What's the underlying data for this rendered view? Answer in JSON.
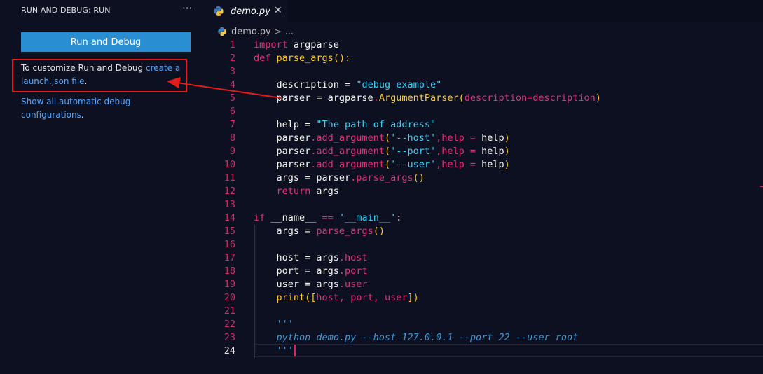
{
  "sidebar": {
    "title": "RUN AND DEBUG: RUN",
    "more": "···",
    "run_button": "Run and Debug",
    "customize_text": "To customize Run and Debug ",
    "customize_link": "create a launch.json file",
    "customize_end": ".",
    "show_all_link": "Show all automatic debug configurations",
    "show_all_end": "."
  },
  "tab": {
    "label": "demo.py",
    "close": "✕"
  },
  "breadcrumb": {
    "file": "demo.py",
    "sep": ">",
    "more": "..."
  },
  "colors": {
    "button": "#2a8ed3",
    "link": "#4fa6ff",
    "annotation": "#e21b1b",
    "editor_bg": "#0c1021"
  },
  "code": {
    "current_line": 24,
    "lines": [
      [
        [
          "k",
          "import"
        ],
        [
          "p",
          " argparse"
        ]
      ],
      [
        [
          "k",
          "def"
        ],
        [
          "p",
          " "
        ],
        [
          "f",
          "parse_args"
        ],
        [
          "f",
          "():"
        ]
      ],
      [],
      [
        [
          "p",
          "    description = "
        ],
        [
          "s",
          "\"debug example\""
        ]
      ],
      [
        [
          "p",
          "    parser = argparse"
        ],
        [
          "m",
          "."
        ],
        [
          "f",
          "ArgumentParser"
        ],
        [
          "f",
          "("
        ],
        [
          "m",
          "description=description"
        ],
        [
          "f",
          ")"
        ]
      ],
      [],
      [
        [
          "p",
          "    help = "
        ],
        [
          "s",
          "\"The path of address\""
        ]
      ],
      [
        [
          "p",
          "    parser"
        ],
        [
          "m",
          ".add_argument"
        ],
        [
          "f",
          "("
        ],
        [
          "s",
          "'--host'"
        ],
        [
          "m",
          ",help = "
        ],
        [
          "p",
          "help"
        ],
        [
          "f",
          ")"
        ]
      ],
      [
        [
          "p",
          "    parser"
        ],
        [
          "m",
          ".add_argument"
        ],
        [
          "f",
          "("
        ],
        [
          "s",
          "'--port'"
        ],
        [
          "m",
          ",help = "
        ],
        [
          "p",
          "help"
        ],
        [
          "f",
          ")"
        ]
      ],
      [
        [
          "p",
          "    parser"
        ],
        [
          "m",
          ".add_argument"
        ],
        [
          "f",
          "("
        ],
        [
          "s",
          "'--user'"
        ],
        [
          "m",
          ",help = "
        ],
        [
          "p",
          "help"
        ],
        [
          "f",
          ")"
        ]
      ],
      [
        [
          "p",
          "    args = parser"
        ],
        [
          "m",
          ".parse_args"
        ],
        [
          "f",
          "()"
        ]
      ],
      [
        [
          "k",
          "    return"
        ],
        [
          "p",
          " args"
        ]
      ],
      [],
      [
        [
          "k",
          "if"
        ],
        [
          "p",
          " __name__ "
        ],
        [
          "k",
          "=="
        ],
        [
          "p",
          " "
        ],
        [
          "s",
          "'__main__'"
        ],
        [
          "p",
          ":"
        ]
      ],
      [
        [
          "p",
          "    args = "
        ],
        [
          "m",
          "parse_args"
        ],
        [
          "f",
          "()"
        ]
      ],
      [],
      [
        [
          "p",
          "    host = args"
        ],
        [
          "m",
          ".host"
        ]
      ],
      [
        [
          "p",
          "    port = args"
        ],
        [
          "m",
          ".port"
        ]
      ],
      [
        [
          "p",
          "    user = args"
        ],
        [
          "m",
          ".user"
        ]
      ],
      [
        [
          "f",
          "    print"
        ],
        [
          "f",
          "(["
        ],
        [
          "m",
          "host, port, user"
        ],
        [
          "f",
          "])"
        ]
      ],
      [],
      [
        [
          "c",
          "    '''"
        ]
      ],
      [
        [
          "c",
          "    python demo.py --host 127.0.0.1 --port 22 --user root"
        ]
      ],
      [
        [
          "c",
          "    '''"
        ]
      ]
    ]
  }
}
